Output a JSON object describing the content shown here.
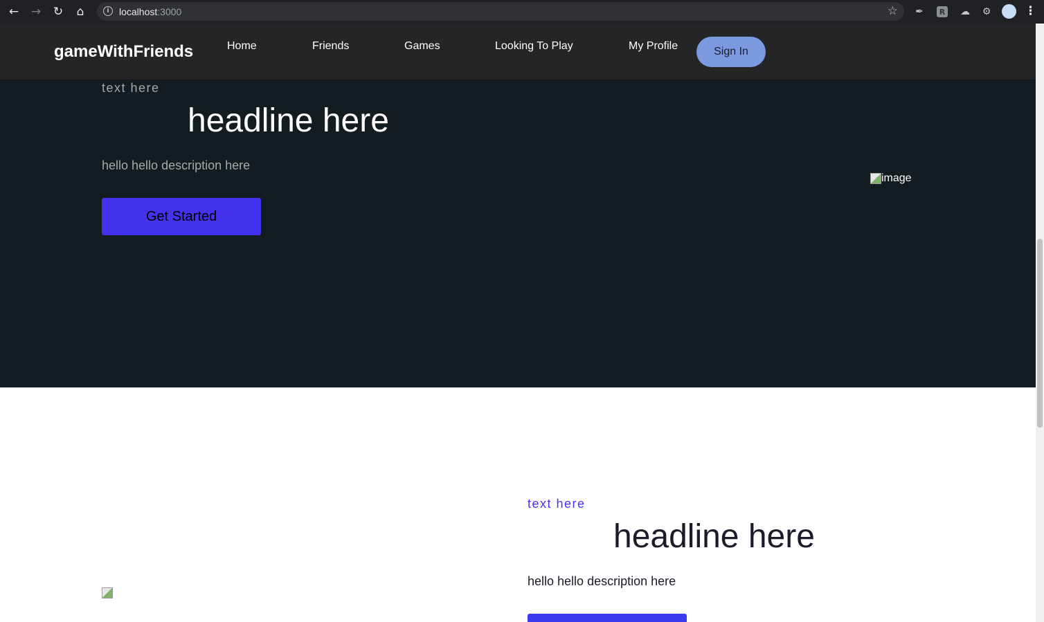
{
  "browser": {
    "url_host": "localhost",
    "url_port": ":3000"
  },
  "navbar": {
    "logo": "gameWithFriends",
    "links": [
      "Home",
      "Friends",
      "Games",
      "Looking To Play",
      "My Profile"
    ],
    "signin_label": "Sign In"
  },
  "hero": {
    "eyebrow": "text here",
    "headline": "headline here",
    "description": "hello hello description here",
    "cta_label": "Get Started",
    "image_alt": "image"
  },
  "section2": {
    "eyebrow": "text here",
    "headline": "headline here",
    "description": "hello hello description here"
  },
  "colors": {
    "navbar_bg": "#242526",
    "hero_bg": "#131c21",
    "accent": "#4433ee",
    "signin_bg": "#7c9ae0"
  }
}
